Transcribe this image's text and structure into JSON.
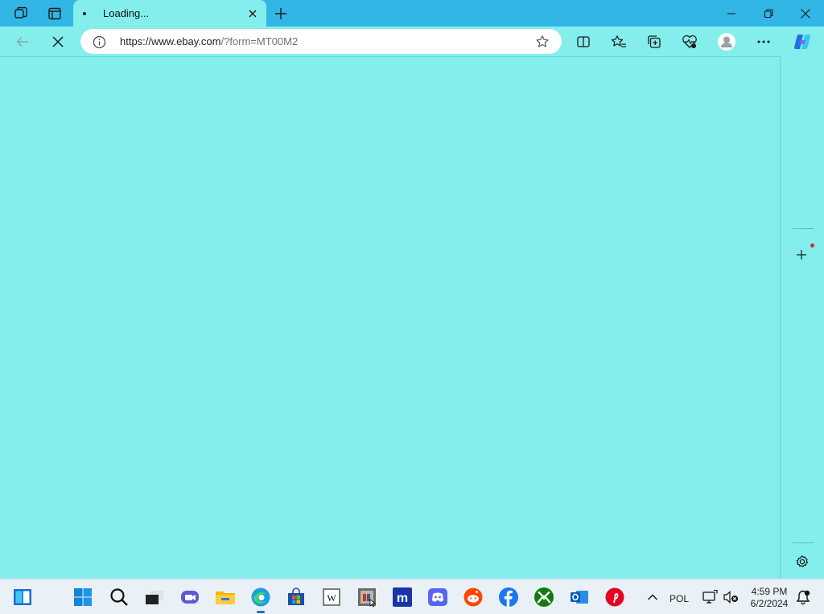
{
  "browser": {
    "tab_title": "Loading...",
    "url_main": "https://www.ebay.com",
    "url_rest": "/?form=MT00M2"
  },
  "taskbar": {
    "language": "POL",
    "time": "4:59 PM",
    "date": "6/2/2024",
    "icons": [
      "widgets-icon",
      "start-icon",
      "search-icon",
      "task-view-icon",
      "teams-icon",
      "file-explorer-icon",
      "edge-icon",
      "store-icon",
      "wikipedia-icon",
      "media-icon",
      "m-app-icon",
      "discord-icon",
      "reddit-icon",
      "facebook-icon",
      "xbox-icon",
      "outlook-icon",
      "pinterest-icon"
    ]
  },
  "colors": {
    "title_bar": "#31b6e6",
    "page_bg": "#84eeec",
    "taskbar_bg": "#eaf1f6"
  }
}
